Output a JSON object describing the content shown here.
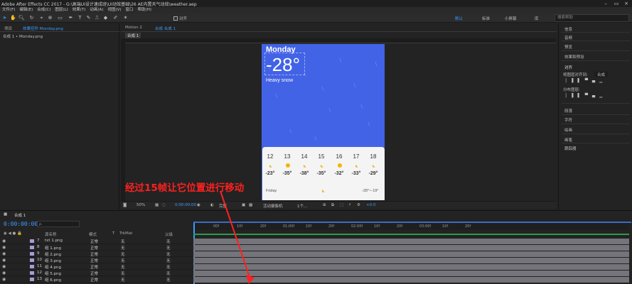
{
  "app": {
    "title": "Adobe After Effects CC 2017 - G:\\高端UI设计速成班\\UI动效基础\\26 AE内置天气动效\\weather.aep",
    "menu": [
      "文件(F)",
      "编辑(E)",
      "合成(C)",
      "图层(L)",
      "效果(T)",
      "动画(A)",
      "视图(V)",
      "窗口",
      "帮助(H)"
    ]
  },
  "toolbar": {
    "snap_label": "对齐",
    "workspaces": [
      "默认",
      "标准",
      "小屏幕",
      "库"
    ],
    "active_workspace": "默认",
    "search_placeholder": "搜索帮助"
  },
  "project_panel": {
    "tabs": [
      "项目",
      "效果控件 Monday.png"
    ],
    "active_tab": "效果控件 Monday.png",
    "breadcrumb": "合成 1 • Monday.png"
  },
  "viewer": {
    "tabs": [
      "Motion 2",
      "合成 合成 1"
    ],
    "active_tab": "合成 合成 1",
    "comp_chip": "合成 1",
    "weather": {
      "day": "Monday",
      "temp": "-28°",
      "condition": "Heavy snow",
      "hours": [
        "12",
        "13",
        "14",
        "15",
        "16",
        "17",
        "18"
      ],
      "temps": [
        "-23°",
        "-35°",
        "-38°",
        "-35°",
        "-32°",
        "-33°",
        "-29°"
      ],
      "next_day": "Friday",
      "next_range": "-28°~-19°"
    },
    "annotation": "经过15帧让它位置进行移动",
    "controls": {
      "zoom": "50%",
      "timecode": "0:00:00:00",
      "quality": "完整",
      "camera": "活动摄像机",
      "views": "1个...",
      "exposure": "+0.0"
    },
    "accent": "#4263e6"
  },
  "right_panel": {
    "items": [
      "信息",
      "音频",
      "预览",
      "效果和预设",
      "对齐",
      "将图层对齐到:",
      "合成",
      "分布图层:",
      "段落",
      "字符",
      "绘画",
      "画笔",
      "跟踪器"
    ]
  },
  "timeline": {
    "tab": "合成 1",
    "timecode": "0:00:00:00",
    "search_placeholder": "ρ.",
    "columns": [
      "源名称",
      "模式",
      "T",
      "TrkMat",
      "父级"
    ],
    "ticks": [
      "00f",
      "10f",
      "20f",
      "01:00f",
      "10f",
      "20f",
      "02:00f",
      "10f",
      "20f",
      "03:00f",
      "10f",
      "20f"
    ],
    "layers": [
      {
        "num": "7",
        "name": "txt 1.png",
        "mode": "正常",
        "trkmat": "无"
      },
      {
        "num": "8",
        "name": "组 1.png",
        "mode": "正常",
        "trkmat": "无"
      },
      {
        "num": "9",
        "name": "组 2.png",
        "mode": "正常",
        "trkmat": "无"
      },
      {
        "num": "10",
        "name": "组 3.png",
        "mode": "正常",
        "trkmat": "无"
      },
      {
        "num": "11",
        "name": "组 4.png",
        "mode": "正常",
        "trkmat": "无"
      },
      {
        "num": "12",
        "name": "组 5.png",
        "mode": "正常",
        "trkmat": "无"
      },
      {
        "num": "13",
        "name": "组 6.png",
        "mode": "正常",
        "trkmat": "无"
      }
    ],
    "parent_none": "无"
  }
}
